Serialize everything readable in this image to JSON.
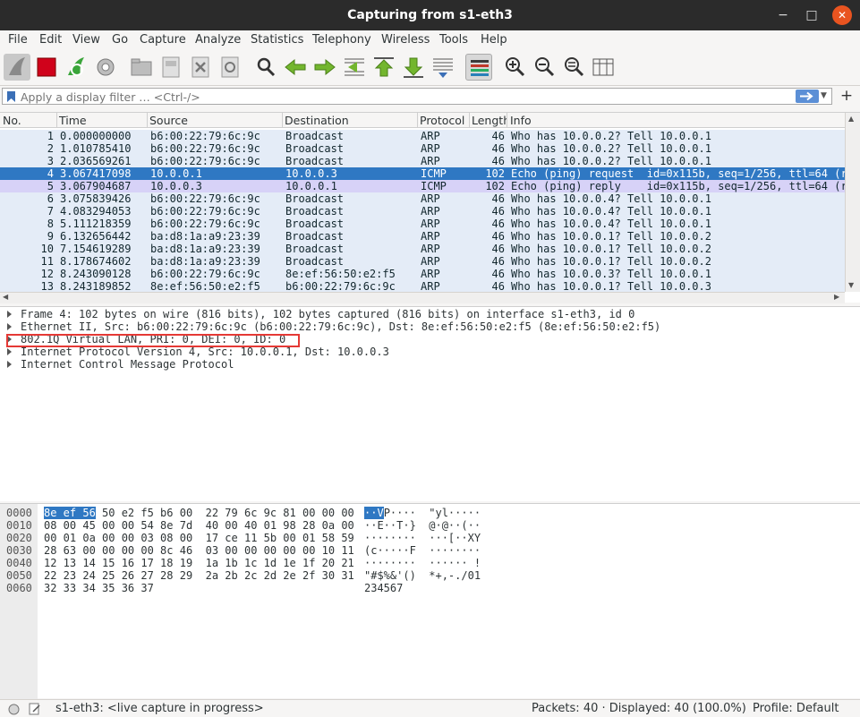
{
  "window": {
    "title": "Capturing from s1-eth3",
    "minimize": "−",
    "maximize": "□",
    "close": "✕"
  },
  "menu": [
    "File",
    "Edit",
    "View",
    "Go",
    "Capture",
    "Analyze",
    "Statistics",
    "Telephony",
    "Wireless",
    "Tools",
    "Help"
  ],
  "toolbar": {
    "icons": [
      "shark-fin-start-icon",
      "stop-capture-icon",
      "restart-capture-icon",
      "capture-options-icon",
      "open-file-icon",
      "save-file-icon",
      "close-file-icon",
      "reload-file-icon",
      "find-packet-icon",
      "go-back-icon",
      "go-forward-icon",
      "go-to-packet-icon",
      "first-packet-icon",
      "last-packet-icon",
      "autoscroll-icon",
      "colorize-icon",
      "zoom-in-icon",
      "zoom-out-icon",
      "normal-size-icon",
      "resize-columns-icon"
    ]
  },
  "filter": {
    "placeholder": "Apply a display filter … <Ctrl-/>"
  },
  "packet_list": {
    "columns": [
      "No.",
      "Time",
      "Source",
      "Destination",
      "Protocol",
      "Length",
      "Info"
    ],
    "rows": [
      {
        "no": "1",
        "time": "0.000000000",
        "src": "b6:00:22:79:6c:9c",
        "dst": "Broadcast",
        "proto": "ARP",
        "len": "46",
        "info": "Who has 10.0.0.2? Tell 10.0.0.1",
        "state": "normal"
      },
      {
        "no": "2",
        "time": "1.010785410",
        "src": "b6:00:22:79:6c:9c",
        "dst": "Broadcast",
        "proto": "ARP",
        "len": "46",
        "info": "Who has 10.0.0.2? Tell 10.0.0.1",
        "state": "normal"
      },
      {
        "no": "3",
        "time": "2.036569261",
        "src": "b6:00:22:79:6c:9c",
        "dst": "Broadcast",
        "proto": "ARP",
        "len": "46",
        "info": "Who has 10.0.0.2? Tell 10.0.0.1",
        "state": "normal"
      },
      {
        "no": "4",
        "time": "3.067417098",
        "src": "10.0.0.1",
        "dst": "10.0.0.3",
        "proto": "ICMP",
        "len": "102",
        "info": "Echo (ping) request  id=0x115b, seq=1/256, ttl=64 (r",
        "state": "selected"
      },
      {
        "no": "5",
        "time": "3.067904687",
        "src": "10.0.0.3",
        "dst": "10.0.0.1",
        "proto": "ICMP",
        "len": "102",
        "info": "Echo (ping) reply    id=0x115b, seq=1/256, ttl=64 (r",
        "state": "icmp"
      },
      {
        "no": "6",
        "time": "3.075839426",
        "src": "b6:00:22:79:6c:9c",
        "dst": "Broadcast",
        "proto": "ARP",
        "len": "46",
        "info": "Who has 10.0.0.4? Tell 10.0.0.1",
        "state": "normal"
      },
      {
        "no": "7",
        "time": "4.083294053",
        "src": "b6:00:22:79:6c:9c",
        "dst": "Broadcast",
        "proto": "ARP",
        "len": "46",
        "info": "Who has 10.0.0.4? Tell 10.0.0.1",
        "state": "normal"
      },
      {
        "no": "8",
        "time": "5.111218359",
        "src": "b6:00:22:79:6c:9c",
        "dst": "Broadcast",
        "proto": "ARP",
        "len": "46",
        "info": "Who has 10.0.0.4? Tell 10.0.0.1",
        "state": "normal"
      },
      {
        "no": "9",
        "time": "6.132656442",
        "src": "ba:d8:1a:a9:23:39",
        "dst": "Broadcast",
        "proto": "ARP",
        "len": "46",
        "info": "Who has 10.0.0.1? Tell 10.0.0.2",
        "state": "normal"
      },
      {
        "no": "10",
        "time": "7.154619289",
        "src": "ba:d8:1a:a9:23:39",
        "dst": "Broadcast",
        "proto": "ARP",
        "len": "46",
        "info": "Who has 10.0.0.1? Tell 10.0.0.2",
        "state": "normal"
      },
      {
        "no": "11",
        "time": "8.178674602",
        "src": "ba:d8:1a:a9:23:39",
        "dst": "Broadcast",
        "proto": "ARP",
        "len": "46",
        "info": "Who has 10.0.0.1? Tell 10.0.0.2",
        "state": "normal"
      },
      {
        "no": "12",
        "time": "8.243090128",
        "src": "b6:00:22:79:6c:9c",
        "dst": "8e:ef:56:50:e2:f5",
        "proto": "ARP",
        "len": "46",
        "info": "Who has 10.0.0.3? Tell 10.0.0.1",
        "state": "normal"
      },
      {
        "no": "13",
        "time": "8.243189852",
        "src": "8e:ef:56:50:e2:f5",
        "dst": "b6:00:22:79:6c:9c",
        "proto": "ARP",
        "len": "46",
        "info": "Who has 10.0.0.1? Tell 10.0.0.3",
        "state": "normal"
      }
    ]
  },
  "details": [
    "Frame 4: 102 bytes on wire (816 bits), 102 bytes captured (816 bits) on interface s1-eth3, id 0",
    "Ethernet II, Src: b6:00:22:79:6c:9c (b6:00:22:79:6c:9c), Dst: 8e:ef:56:50:e2:f5 (8e:ef:56:50:e2:f5)",
    "802.1Q Virtual LAN, PRI: 0, DEI: 0, ID: 0",
    "Internet Protocol Version 4, Src: 10.0.0.1, Dst: 10.0.0.3",
    "Internet Control Message Protocol"
  ],
  "bytes": [
    {
      "offset": "0000",
      "hex_hl": "8e ef 56",
      "hex": " 50 e2 f5 b6 00  22 79 6c 9c 81 00 00 00",
      "ascii_hl": "··V",
      "ascii": "P····  \"yl·····"
    },
    {
      "offset": "0010",
      "hex_hl": "",
      "hex": "08 00 45 00 00 54 8e 7d  40 00 40 01 98 28 0a 00",
      "ascii_hl": "",
      "ascii": "··E··T·}  @·@··(··"
    },
    {
      "offset": "0020",
      "hex_hl": "",
      "hex": "00 01 0a 00 00 03 08 00  17 ce 11 5b 00 01 58 59",
      "ascii_hl": "",
      "ascii": "········  ···[··XY"
    },
    {
      "offset": "0030",
      "hex_hl": "",
      "hex": "28 63 00 00 00 00 8c 46  03 00 00 00 00 00 10 11",
      "ascii_hl": "",
      "ascii": "(c·····F  ········"
    },
    {
      "offset": "0040",
      "hex_hl": "",
      "hex": "12 13 14 15 16 17 18 19  1a 1b 1c 1d 1e 1f 20 21",
      "ascii_hl": "",
      "ascii": "········  ······ !"
    },
    {
      "offset": "0050",
      "hex_hl": "",
      "hex": "22 23 24 25 26 27 28 29  2a 2b 2c 2d 2e 2f 30 31",
      "ascii_hl": "",
      "ascii": "\"#$%&'()  *+,-./01"
    },
    {
      "offset": "0060",
      "hex_hl": "",
      "hex": "32 33 34 35 36 37",
      "ascii_hl": "",
      "ascii": "234567"
    }
  ],
  "status": {
    "interface": "s1-eth3: <live capture in progress>",
    "counts": "Packets: 40 · Displayed: 40 (100.0%)",
    "profile": "Profile: Default"
  },
  "colors": {
    "selected_row": "#2f78c3",
    "arp_row": "#e4ecf7",
    "icmp_row": "#d7d2f7",
    "highlight_box": "#e53935",
    "close_button": "#e95420"
  }
}
